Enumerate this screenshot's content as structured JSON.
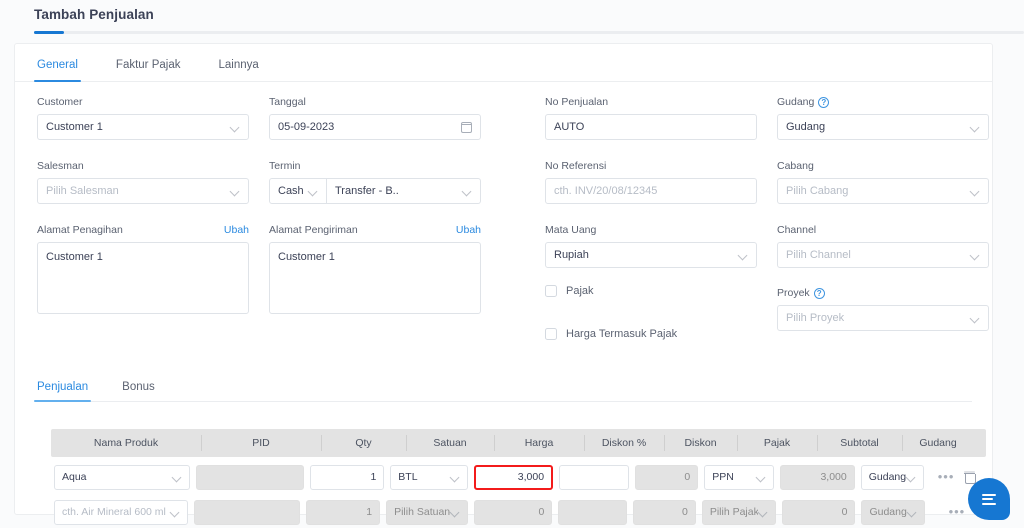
{
  "page": {
    "title": "Tambah Penjualan",
    "progress_percent": 3,
    "accent_color": "#2b8ae0",
    "error_color": "#f31b1b"
  },
  "tabs": [
    {
      "label": "General",
      "active": true
    },
    {
      "label": "Faktur Pajak",
      "active": false
    },
    {
      "label": "Lainnya",
      "active": false
    }
  ],
  "form": {
    "customer": {
      "label": "Customer",
      "value": "Customer 1",
      "icon": "chevron-down-icon"
    },
    "tanggal": {
      "label": "Tanggal",
      "value": "05-09-2023",
      "icon": "calendar-icon"
    },
    "no_penjualan": {
      "label": "No Penjualan",
      "value": "AUTO"
    },
    "gudang": {
      "label": "Gudang",
      "value": "Gudang",
      "help_icon": "help-circle-icon",
      "icon": "chevron-down-icon"
    },
    "salesman": {
      "label": "Salesman",
      "placeholder": "Pilih Salesman",
      "icon": "chevron-down-icon"
    },
    "termin": {
      "label": "Termin",
      "type_value": "Cash",
      "method_value": "Transfer - B.."
    },
    "no_referensi": {
      "label": "No Referensi",
      "placeholder": "cth. INV/20/08/12345"
    },
    "cabang": {
      "label": "Cabang",
      "placeholder": "Pilih Cabang",
      "icon": "chevron-down-icon"
    },
    "alamat_penagihan": {
      "label": "Alamat Penagihan",
      "action": "Ubah",
      "value": "Customer 1"
    },
    "alamat_pengiriman": {
      "label": "Alamat Pengiriman",
      "action": "Ubah",
      "value": "Customer 1"
    },
    "mata_uang": {
      "label": "Mata Uang",
      "value": "Rupiah",
      "icon": "chevron-down-icon"
    },
    "channel": {
      "label": "Channel",
      "placeholder": "Pilih Channel",
      "icon": "chevron-down-icon"
    },
    "proyek": {
      "label": "Proyek",
      "placeholder": "Pilih Proyek",
      "help_icon": "help-circle-icon",
      "icon": "chevron-down-icon"
    },
    "pajak_checkbox": {
      "label": "Pajak",
      "checked": false
    },
    "harga_termasuk_pajak_checkbox": {
      "label": "Harga Termasuk Pajak",
      "checked": false
    }
  },
  "sub_tabs": [
    {
      "label": "Penjualan",
      "active": true
    },
    {
      "label": "Bonus",
      "active": false
    }
  ],
  "table": {
    "columns": [
      "Nama Produk",
      "PID",
      "Qty",
      "Satuan",
      "Harga",
      "Diskon %",
      "Diskon",
      "Pajak",
      "Subtotal",
      "Gudang",
      ""
    ],
    "rows": [
      {
        "nama_produk": "Aqua",
        "pid": "",
        "qty": "1",
        "satuan": "BTL",
        "harga": "3,000",
        "diskon_persen": "",
        "diskon": "0",
        "pajak": "PPN",
        "subtotal": "3,000",
        "gudang": "Gudang",
        "more_icon": "ellipsis-icon",
        "delete_icon": "trash-icon",
        "harga_error": true,
        "placeholder_row": false
      },
      {
        "nama_produk": "cth. Air Mineral 600 ml",
        "pid": "",
        "qty": "1",
        "satuan": "Pilih Satuan",
        "harga": "0",
        "diskon_persen": "",
        "diskon": "0",
        "pajak": "Pilih Pajak",
        "subtotal": "0",
        "gudang": "Gudang",
        "more_icon": "ellipsis-icon",
        "delete_icon": "",
        "harga_error": false,
        "placeholder_row": true
      }
    ]
  },
  "chat_fab": {
    "icon": "chat-bubble-icon",
    "color": "#1677d2"
  }
}
